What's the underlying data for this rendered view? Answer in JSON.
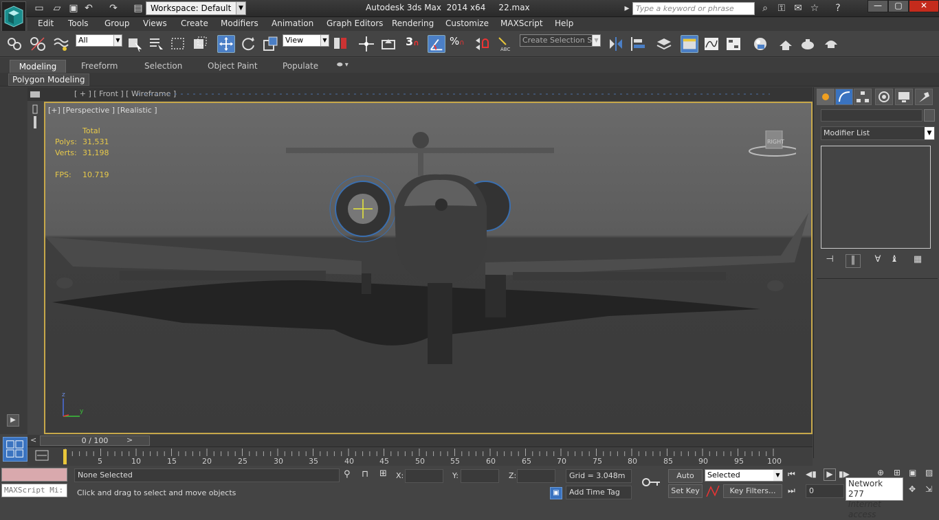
{
  "titlebar": {
    "workspace": "Workspace: Default",
    "title": "Autodesk 3ds Max  2014 x64     22.max",
    "search_placeholder": "Type a keyword or phrase",
    "min": "—",
    "max": "▢",
    "close": "✕"
  },
  "menu": [
    "Edit",
    "Tools",
    "Group",
    "Views",
    "Create",
    "Modifiers",
    "Animation",
    "Graph Editors",
    "Rendering",
    "Customize",
    "MAXScript",
    "Help"
  ],
  "toolbar": {
    "filter": "All",
    "ref_coord": "View",
    "snap_num": "3",
    "named_selection": "Create Selection Se"
  },
  "ribbon": {
    "tabs": [
      "Modeling",
      "Freeform",
      "Selection",
      "Object Paint",
      "Populate"
    ],
    "active_tab": "Modeling",
    "panel_label": "Polygon Modeling"
  },
  "viewport": {
    "front_label": "[ + ] [ Front ] [ Wireframe ]",
    "label": "[+] [Perspective ] [Realistic ]",
    "stats": {
      "header": "Total",
      "polys_label": "Polys:",
      "polys": "31,531",
      "verts_label": "Verts:",
      "verts": "31,198",
      "fps_label": "FPS:",
      "fps": "10.719"
    },
    "viewcube": "RIGHT",
    "axis_z": "z",
    "axis_y": "y"
  },
  "command_panel": {
    "modifier_list": "Modifier List"
  },
  "timeline": {
    "frame": "0 / 100",
    "ticks": [
      "5",
      "10",
      "15",
      "20",
      "25",
      "30",
      "35",
      "40",
      "45",
      "50",
      "55",
      "60",
      "65",
      "70",
      "75",
      "80",
      "85",
      "90",
      "95",
      "100"
    ],
    "zero": "0"
  },
  "status": {
    "maxscript": "MAXScript Mi:",
    "selection": "None Selected",
    "prompt": "Click and drag to select and move objects",
    "x_label": "X:",
    "y_label": "Y:",
    "z_label": "Z:",
    "grid": "Grid = 3.048m",
    "add_time_tag": "Add Time Tag",
    "auto_key": "Auto Key",
    "set_key": "Set Key",
    "key_mode": "Selected",
    "key_filters": "Key Filters...",
    "frame_field": "0"
  },
  "tooltip": {
    "line1": "Network  277",
    "line2": "Internet access"
  }
}
